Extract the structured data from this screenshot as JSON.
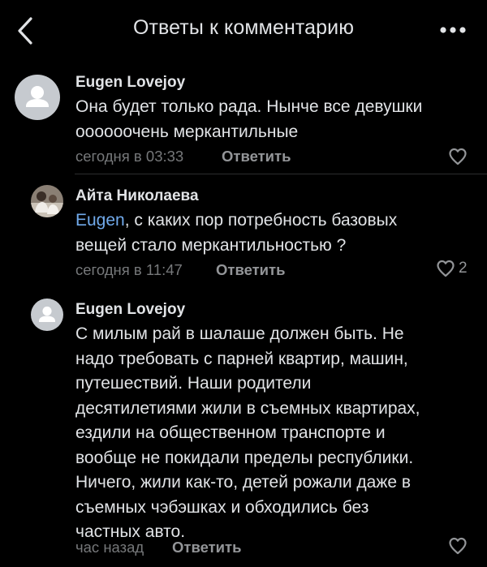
{
  "header": {
    "back_icon": "chevron-left-icon",
    "title": "Ответы к комментарию",
    "more_icon": "more-horizontal-icon"
  },
  "comments": [
    {
      "author": "Eugen Lovejoy",
      "avatar": "placeholder",
      "text": "Она будет только рада. Нынче все девушки\nоооооочень меркантильные",
      "time": "сегодня в 03:33",
      "reply_label": "Ответить",
      "like_icon": "heart-outline-icon",
      "like_count": ""
    },
    {
      "author": "Айта Николаева",
      "avatar": "photo",
      "mention": "Eugen",
      "text": ", с каких пор потребность базовых\nвещей стало меркантильностью ?",
      "time": "сегодня в 11:47",
      "reply_label": "Ответить",
      "like_icon": "heart-outline-icon",
      "like_count": "2"
    },
    {
      "author": "Eugen Lovejoy",
      "avatar": "placeholder",
      "text": "С милым рай в шалаше должен быть. Не\nнадо требовать с парней квартир, машин,\nпутешествий. Наши родители\nдесятилетиями жили в съемных квартирах,\nездили на общественном транспорте и\nвообще не покидали пределы республики.\nНичего, жили как-то, детей рожали даже в\nсъемных чэбэшках и обходились без\nчастных авто.",
      "time": "час назад",
      "reply_label": "Ответить",
      "like_icon": "heart-outline-icon",
      "like_count": ""
    }
  ],
  "colors": {
    "background": "#000000",
    "text": "#e1e3e6",
    "secondary": "#76787a",
    "accent": "#71aaeb",
    "avatar_placeholder": "#c6cacf"
  }
}
